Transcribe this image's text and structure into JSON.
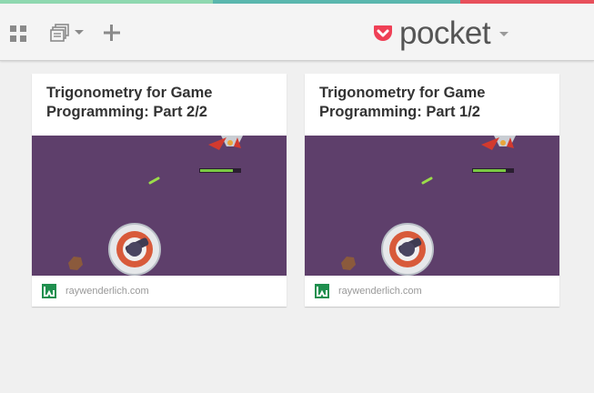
{
  "colors": {
    "stripe": [
      "#8fd8b0",
      "#5ab7ae",
      "#e8505b"
    ],
    "brand": "#ef4056",
    "toolbar_icon": "#8a8a8a",
    "thumb_bg": "#5e3f6b",
    "domain_icon": "#1f8f4e"
  },
  "toolbar": {
    "grid_icon": "grid-view-icon",
    "list_icon": "list-view-icon",
    "add_icon": "plus-icon",
    "logo_text": "pocket",
    "logo_icon": "pocket-icon"
  },
  "cards": [
    {
      "title": "Trigonometry for Game Programming: Part 2/2",
      "domain": "raywenderlich.com",
      "domain_icon": "raywenderlich-icon"
    },
    {
      "title": "Trigonometry for Game Programming: Part 1/2",
      "domain": "raywenderlich.com",
      "domain_icon": "raywenderlich-icon"
    }
  ]
}
